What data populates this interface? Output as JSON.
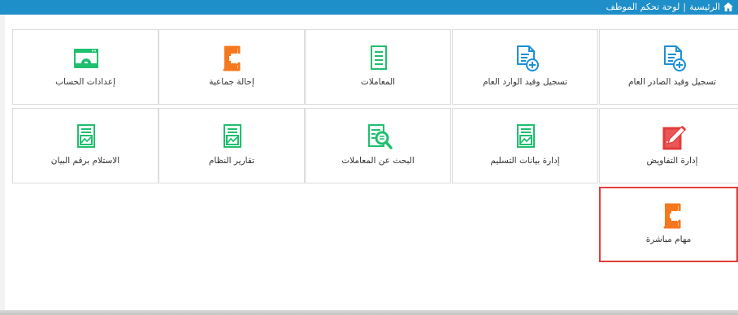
{
  "header": {
    "home_label": "الرئيسية",
    "separator": "|",
    "current_label": "لوحة تحكم الموظف"
  },
  "colors": {
    "header_bg": "#1f8fc9",
    "green": "#1fbf6f",
    "blue": "#1b8fd6",
    "orange": "#f5781e",
    "red": "#e43b3b"
  },
  "tiles": [
    {
      "label": "تسجيل وقيد الصادر العام",
      "icon": "document-add-icon"
    },
    {
      "label": "تسجيل وقيد الوارد العام",
      "icon": "document-add-icon"
    },
    {
      "label": "المعاملات",
      "icon": "document-lines-icon"
    },
    {
      "label": "إحالة جماعية",
      "icon": "exit-arrow-icon"
    },
    {
      "label": "إعدادات الحساب",
      "icon": "browser-settings-icon"
    },
    {
      "label": "إدارة التفاويض",
      "icon": "pencil-document-icon"
    },
    {
      "label": "إدارة بيانات التسليم",
      "icon": "chart-document-icon"
    },
    {
      "label": "البحث عن المعاملات",
      "icon": "search-document-icon"
    },
    {
      "label": "تقارير النظام",
      "icon": "chart-document-icon"
    },
    {
      "label": "الاستلام برقم البيان",
      "icon": "chart-document-icon"
    },
    {
      "label": "مهام مباشرة",
      "icon": "exit-arrow-icon"
    }
  ]
}
